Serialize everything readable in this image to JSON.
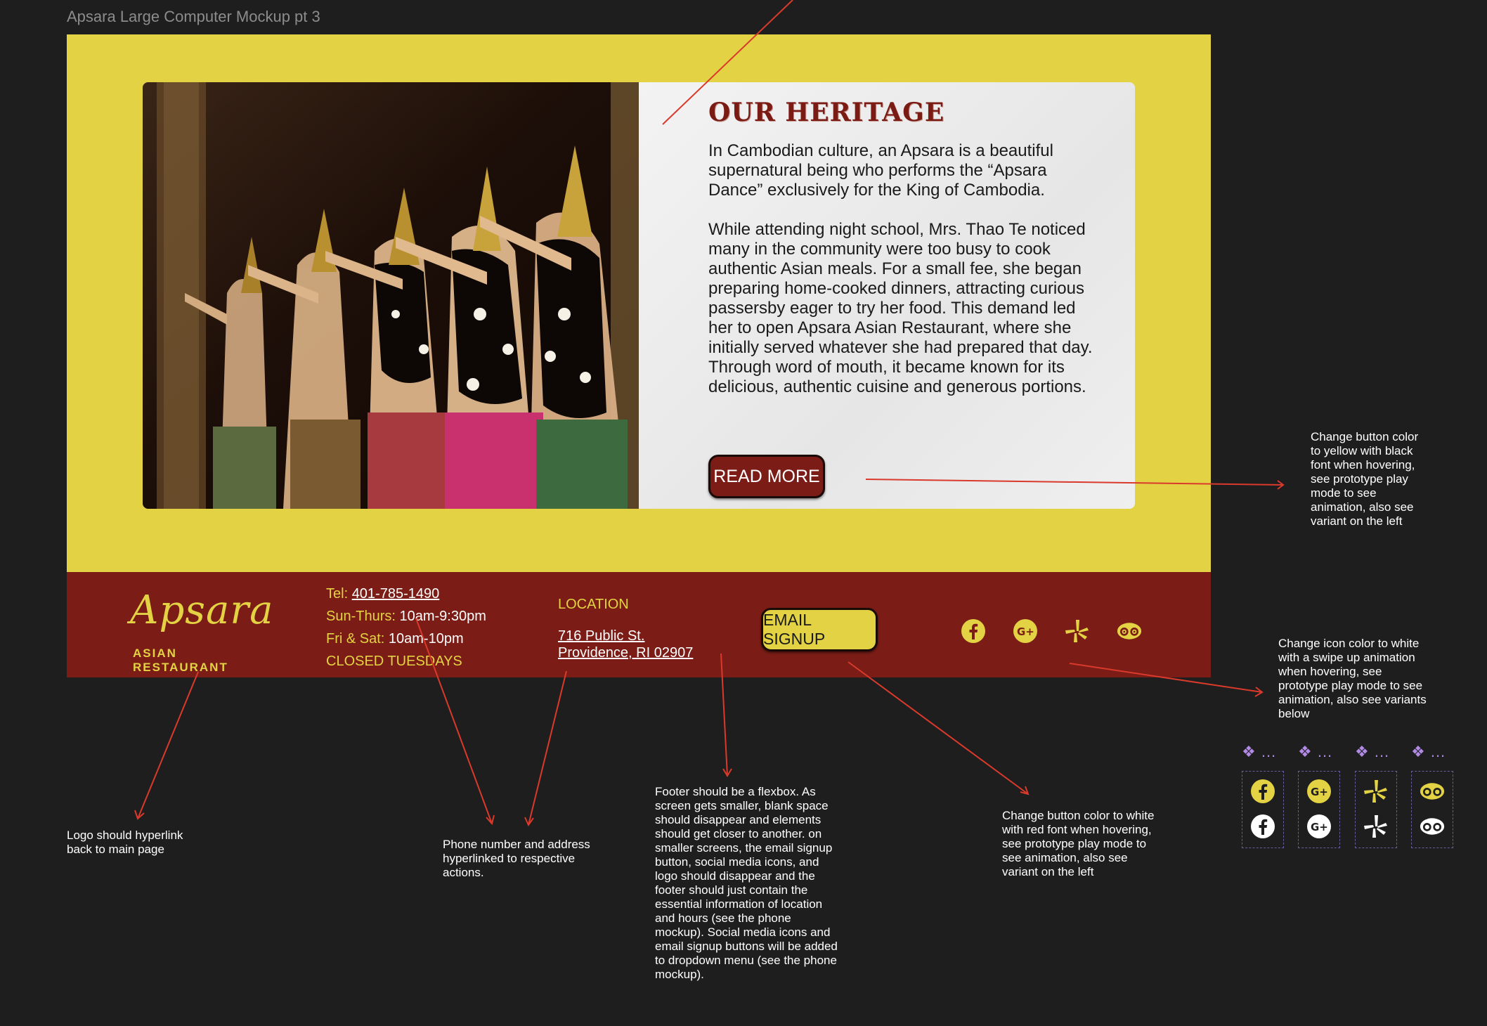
{
  "frame_title": "Apsara Large Computer Mockup pt 3",
  "hero": {
    "heading": "OUR HERITAGE",
    "para1": "In Cambodian culture, an Apsara is a beautiful supernatural being who performs the “Apsara Dance” exclusively for the King of Cambodia.",
    "para2": "While attending night school, Mrs. Thao Te noticed many in the community were too busy to cook authentic Asian meals. For a small fee, she began preparing home-cooked dinners, attracting curious passersby eager to try her food. This demand led her to open Apsara Asian Restaurant, where she initially served whatever she had prepared that day. Through word of mouth, it became known for its delicious, authentic cuisine and generous portions.",
    "read_more": "READ MORE"
  },
  "footer": {
    "logo_script": "Apsara",
    "logo_sub": "ASIAN RESTAURANT",
    "tel_label": "Tel: ",
    "tel_value": "401-785-1490",
    "sun_label": "Sun-Thurs: ",
    "sun_value": "10am-9:30pm",
    "fri_label": "Fri & Sat: ",
    "fri_value": "10am-10pm",
    "closed": "CLOSED TUESDAYS",
    "location_title": "LOCATION",
    "address_line1": "716 Public St.",
    "address_line2": "Providence, RI 02907",
    "email_signup": "EMAIL SIGNUP",
    "social_icons": [
      "facebook-icon",
      "google-plus-icon",
      "yelp-icon",
      "tripadvisor-icon"
    ]
  },
  "annotations": {
    "read_more_note": "Change button color to yellow with black font when hovering, see prototype play mode to see animation, also see variant on the left",
    "icon_note": "Change icon color to white with a swipe up animation when hovering, see prototype play mode to see animation, also see variants below",
    "logo_note": "Logo should hyperlink back to main page",
    "phone_note": "Phone number and address hyperlinked to respective actions.",
    "footer_note": "Footer should be a flexbox. As screen gets smaller, blank space should disappear and elements should get closer to another. on smaller screens, the email signup button, social media icons, and logo should disappear and the footer should just contain the essential information of location and hours (see the phone mockup). Social media icons and email signup buttons will be added to dropdown menu (see the phone mockup).",
    "email_note": "Change button color to white with red font when hovering, see prototype play mode to see animation, also see variant on the left"
  },
  "variants": {
    "label": "❖ ..."
  },
  "colors": {
    "yellow": "#e3d344",
    "maroon": "#7b1d16",
    "annotation_red": "#d93a2b",
    "variant_purple": "#b18be6"
  }
}
